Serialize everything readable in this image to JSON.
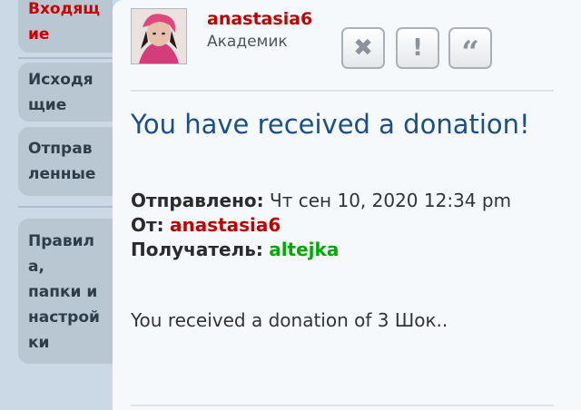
{
  "sidebar": {
    "items": [
      {
        "label": "Входящ\nие"
      },
      {
        "label": "Исходя\nщие"
      },
      {
        "label": "Отправ\nленные"
      },
      {
        "label": "Правил\nа,\nпапки и\nнастрой\nки"
      }
    ]
  },
  "post": {
    "username": "anastasia6",
    "rank": "Академик",
    "subject": "You have received a donation!",
    "sent_label": "Отправлено:",
    "sent_value": "Чт сен 10, 2020 12:34 pm",
    "from_label": "От:",
    "from_value": "anastasia6",
    "to_label": "Получатель:",
    "to_value": "altejka",
    "body": "You received a donation of 3 Шок.."
  },
  "buttons": [
    {
      "icon": "close-icon"
    },
    {
      "icon": "exclamation-icon"
    },
    {
      "icon": "quote-icon"
    }
  ],
  "colors": {
    "username": "#c00000",
    "recipient": "#00aa00",
    "subject": "#1b4f8a"
  }
}
